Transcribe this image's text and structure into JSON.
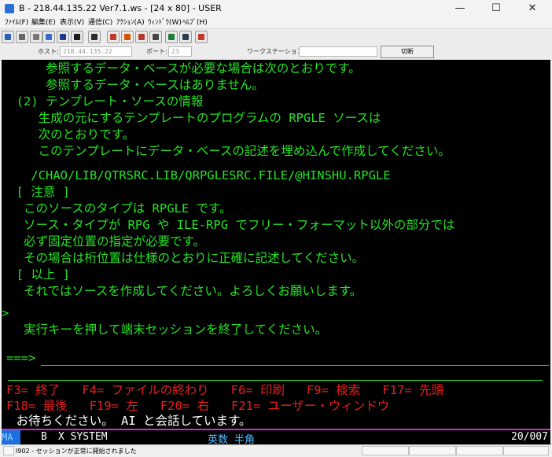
{
  "window": {
    "title": "B - 218.44.135.22 Ver7.1.ws - [24 x 80] - USER",
    "minimize": "—",
    "maximize": "☐",
    "close": "✕"
  },
  "menu": [
    {
      "label": "ﾌｧｲﾙ(F)"
    },
    {
      "label": "編集(E)"
    },
    {
      "label": "表示(V)"
    },
    {
      "label": "通信(C)"
    },
    {
      "label": "ｱｸｼｮﾝ(A)"
    },
    {
      "label": "ｳｨﾝﾄﾞｳ(W)"
    },
    {
      "label": "ﾍﾙﾌﾟ(H)"
    }
  ],
  "toolbar": {
    "buttons": [
      {
        "icon": "screen-icon",
        "color": "#2c5fb8"
      },
      {
        "icon": "copy-icon",
        "color": "#666666"
      },
      {
        "icon": "paste-icon",
        "color": "#777777"
      },
      {
        "icon": "select-icon",
        "color": "#3b6bc9"
      },
      {
        "icon": "session-icon",
        "color": "#223a8a"
      },
      {
        "icon": "monitor-icon",
        "color": "#1a1a1a"
      },
      {
        "icon": "display-icon",
        "color": "#2d2d2d"
      },
      {
        "icon": "chart-icon",
        "color": "#c0392b"
      },
      {
        "icon": "record-icon",
        "color": "#d35400"
      },
      {
        "icon": "play-icon",
        "color": "#b03a2e"
      },
      {
        "icon": "stop-icon",
        "color": "#444444"
      },
      {
        "icon": "globe-icon",
        "color": "#1e7e34"
      },
      {
        "icon": "macro-icon",
        "color": "#2c3e50"
      },
      {
        "icon": "settings-icon",
        "color": "#c0392b"
      }
    ]
  },
  "connection": {
    "host_label": "ホスト:",
    "host_value": "218.44.135.22",
    "port_label": "ポート:",
    "port_value": "23",
    "ws_label": "ワークステーション ID:",
    "ws_value": "",
    "disconnect_label": "切断"
  },
  "terminal": {
    "lines": [
      "      参照するデータ・ベースが必要な場合は次のとおりです。",
      "      参照するデータ・ベースはありません。",
      "  (2) テンプレート・ソースの情報",
      "     生成の元にするテンプレートのプログラムの RPGLE ソースは",
      "     次のとおりです。",
      "     このテンプレートにデータ・ベースの記述を埋め込んで作成してください。",
      "",
      "    /CHAO/LIB/QTRSRC.LIB/QRPGLESRC.FILE/@HINSHU.RPGLE",
      "  [ 注意 ]",
      "   このソースのタイプは RPGLE です。",
      "   ソース・タイプが RPG や ILE-RPG でフリー・フォーマット以外の部分では",
      "   必ず固定位置の指定が必要です。",
      "   その場合は桁位置は仕様のとおりに正確に記述してください。",
      "  [ 以上 ]",
      "   それではソースを作成してください。よろしくお願いします。",
      "",
      ">",
      "   実行キーを押して端末セッションを終了してください。"
    ],
    "prompt": "===>",
    "command_value": "",
    "function_keys_1": "F3= 終了   F4= ファイルの終わり   F6= 印刷   F9= 検索   F17= 先頭",
    "function_keys_2": "F18= 最後   F19= 左   F20= 右   F21= ユーザー・ウィンドウ",
    "message": "  お待ちください。 AI と会話しています。"
  },
  "oia": {
    "mode": "MA",
    "session": "B",
    "system_indicator": "X SYSTEM",
    "input_mode": "英数 半角",
    "cursor": "20/007"
  },
  "status": {
    "message": "I902 - セッションが正常に開始されました"
  }
}
